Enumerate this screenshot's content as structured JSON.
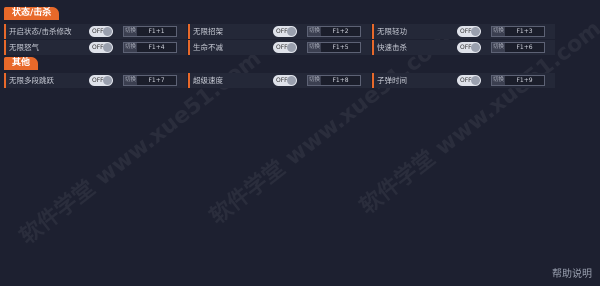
{
  "sections": [
    {
      "title": "状态/击杀",
      "rows": [
        [
          {
            "label": "开启状态/击杀修改",
            "toggle": "OFF",
            "switch": "切换",
            "hotkey": "F1+1"
          },
          {
            "label": "无限招架",
            "toggle": "OFF",
            "switch": "切换",
            "hotkey": "F1+2"
          },
          {
            "label": "无限轻功",
            "toggle": "OFF",
            "switch": "切换",
            "hotkey": "F1+3"
          }
        ],
        [
          {
            "label": "无限怒气",
            "toggle": "OFF",
            "switch": "切换",
            "hotkey": "F1+4"
          },
          {
            "label": "生命不减",
            "toggle": "OFF",
            "switch": "切换",
            "hotkey": "F1+5"
          },
          {
            "label": "快速击杀",
            "toggle": "OFF",
            "switch": "切换",
            "hotkey": "F1+6"
          }
        ]
      ]
    },
    {
      "title": "其他",
      "rows": [
        [
          {
            "label": "无限多段跳跃",
            "toggle": "OFF",
            "switch": "切换",
            "hotkey": "F1+7"
          },
          {
            "label": "超级速度",
            "toggle": "OFF",
            "switch": "切换",
            "hotkey": "F1+8"
          },
          {
            "label": "子弹时间",
            "toggle": "OFF",
            "switch": "切换",
            "hotkey": "F1+9"
          }
        ]
      ]
    }
  ],
  "help_link": "帮助说明",
  "watermark_text": "软件学堂 www.xue51.com",
  "colors": {
    "accent": "#e8692a",
    "background": "#1d2030",
    "cell": "#242838"
  }
}
